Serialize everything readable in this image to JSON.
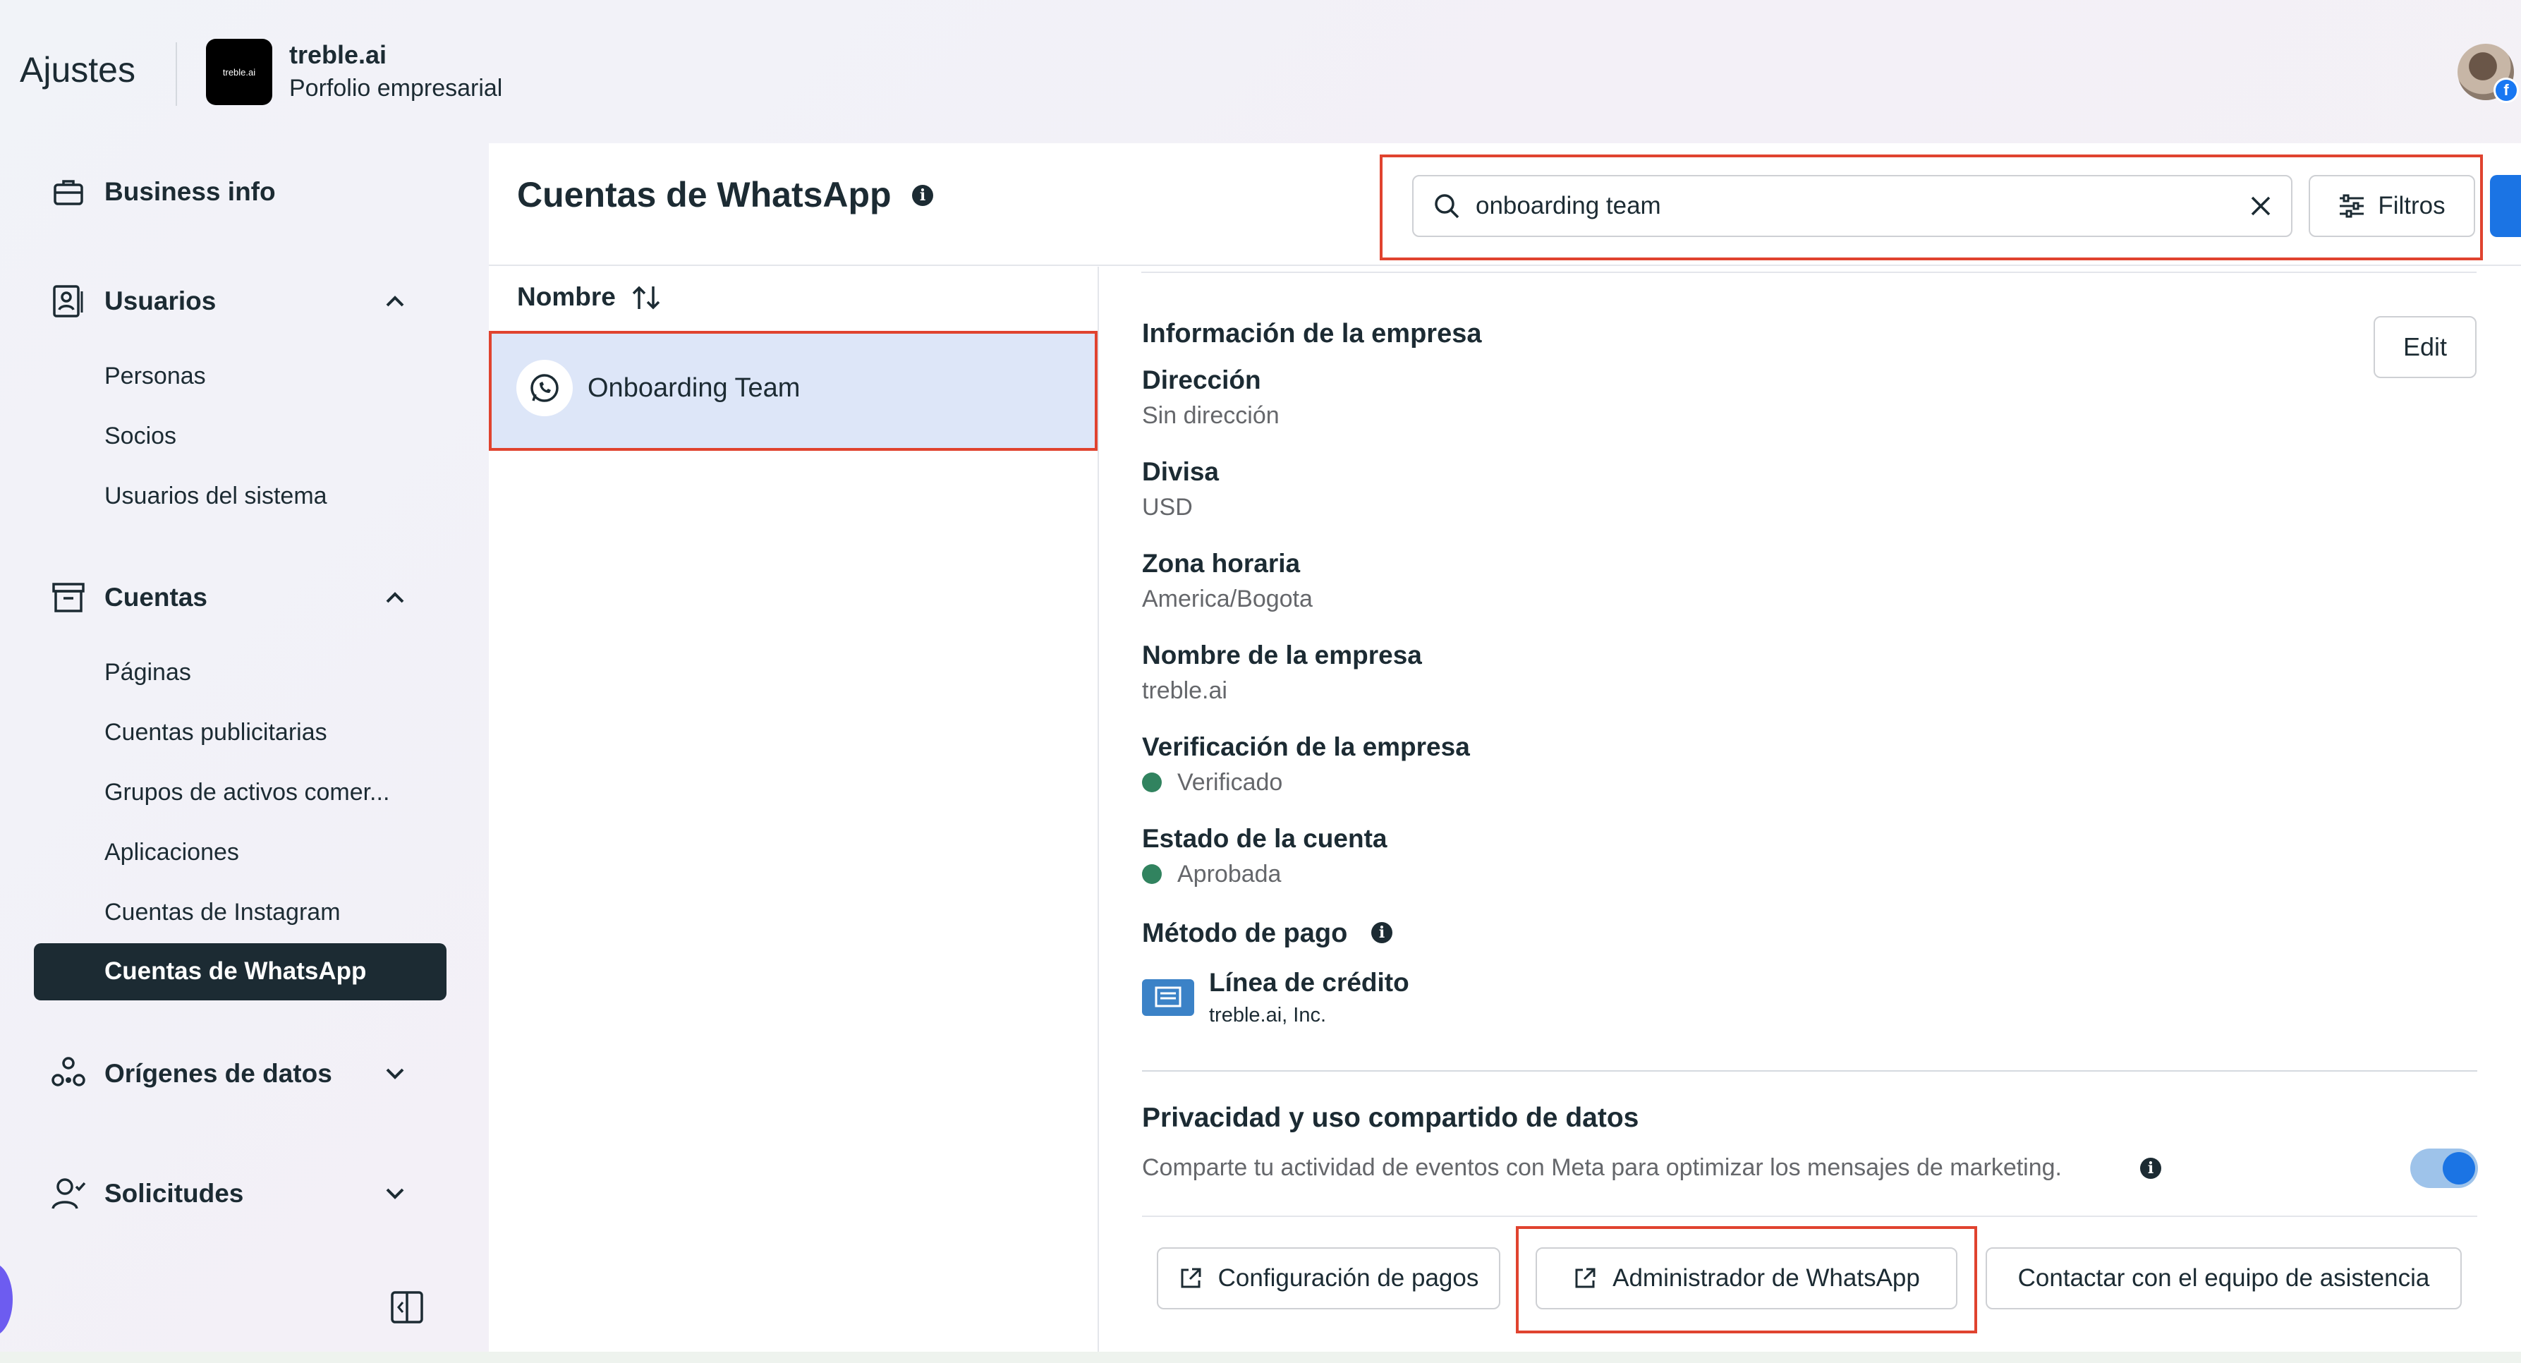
{
  "header": {
    "app_title": "Ajustes",
    "logo_text": "treble.ai",
    "business_name": "treble.ai",
    "business_subtitle": "Porfolio empresarial",
    "avatar_icon": "user-avatar",
    "avatar_badge_icon": "facebook-icon"
  },
  "sidebar": {
    "business_info": "Business info",
    "usuarios": {
      "label": "Usuarios",
      "items": [
        "Personas",
        "Socios",
        "Usuarios del sistema"
      ]
    },
    "cuentas": {
      "label": "Cuentas",
      "items": [
        "Páginas",
        "Cuentas publicitarias",
        "Grupos de activos comer...",
        "Aplicaciones",
        "Cuentas de Instagram",
        "Cuentas de WhatsApp"
      ],
      "active": "Cuentas de WhatsApp"
    },
    "origenes": "Orígenes de datos",
    "solicitudes": "Solicitudes",
    "collapse_icon": "sidebar-collapse-icon"
  },
  "main": {
    "title": "Cuentas de WhatsApp",
    "search": {
      "value": "onboarding team",
      "icon": "search-icon",
      "clear_icon": "close-icon"
    },
    "filters_label": "Filtros",
    "list": {
      "column_header": "Nombre",
      "rows": [
        "Onboarding Team"
      ]
    },
    "detail": {
      "section_title": "Información de la empresa",
      "edit_label": "Edit",
      "fields": [
        {
          "label": "Dirección",
          "value": "Sin dirección"
        },
        {
          "label": "Divisa",
          "value": "USD"
        },
        {
          "label": "Zona horaria",
          "value": "America/Bogota"
        },
        {
          "label": "Nombre de la empresa",
          "value": "treble.ai"
        },
        {
          "label": "Verificación de la empresa",
          "value": "Verificado"
        },
        {
          "label": "Estado de la cuenta",
          "value": "Aprobada"
        }
      ],
      "status_color": "#31835f",
      "payment": {
        "label": "Método de pago",
        "method_title": "Línea de crédito",
        "method_sub": "treble.ai, Inc."
      },
      "privacy": {
        "title": "Privacidad y uso compartido de datos",
        "description": "Comparte tu actividad de eventos con Meta para optimizar los mensajes de marketing.",
        "toggle_on": true
      },
      "buttons": {
        "payments": "Configuración de pagos",
        "whatsapp_manager": "Administrador de WhatsApp",
        "contact_support": "Contactar con el equipo de asistencia"
      }
    }
  },
  "colors": {
    "highlight_border": "#e0432f",
    "selected_row": "#dde6f8",
    "active_nav": "#1c2b33",
    "accent_blue": "#1b74e4"
  }
}
